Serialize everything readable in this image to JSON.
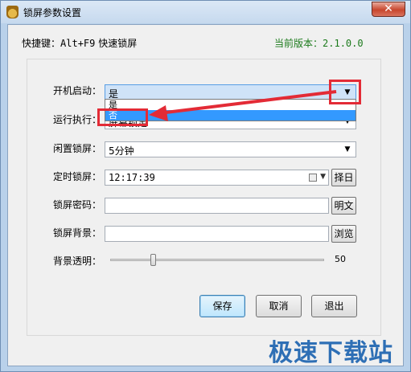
{
  "window": {
    "title": "锁屏参数设置",
    "close_glyph": "✕"
  },
  "header": {
    "hotkey_label": "快捷键：",
    "hotkey_value": "Alt+F9",
    "hotkey_action": "快速锁屏",
    "version_label": "当前版本：",
    "version_value": "2.1.0.0",
    "version_color": "#1b7a1b"
  },
  "form": {
    "startup": {
      "label": "开机启动：",
      "value": "是",
      "options": [
        "是",
        "否"
      ],
      "highlighted_option": "否"
    },
    "run": {
      "label": "运行执行：",
      "value": "屏幕锁定"
    },
    "idle": {
      "label": "闲置锁屏：",
      "value": "5分钟"
    },
    "timed": {
      "label": "定时锁屏：",
      "value": "12:17:39",
      "button": "择日"
    },
    "password": {
      "label": "锁屏密码：",
      "value": "",
      "button": "明文"
    },
    "background": {
      "label": "锁屏背景：",
      "value": "",
      "button": "浏览"
    },
    "opacity": {
      "label": "背景透明：",
      "value": "50",
      "level_fraction": 0.2
    }
  },
  "buttons": {
    "save": "保存",
    "cancel": "取消",
    "exit": "退出"
  },
  "watermark": "极速下载站",
  "colors": {
    "annotation": "#e32b36",
    "selection": "#3399ff",
    "watermark": "#2e6fb5"
  }
}
